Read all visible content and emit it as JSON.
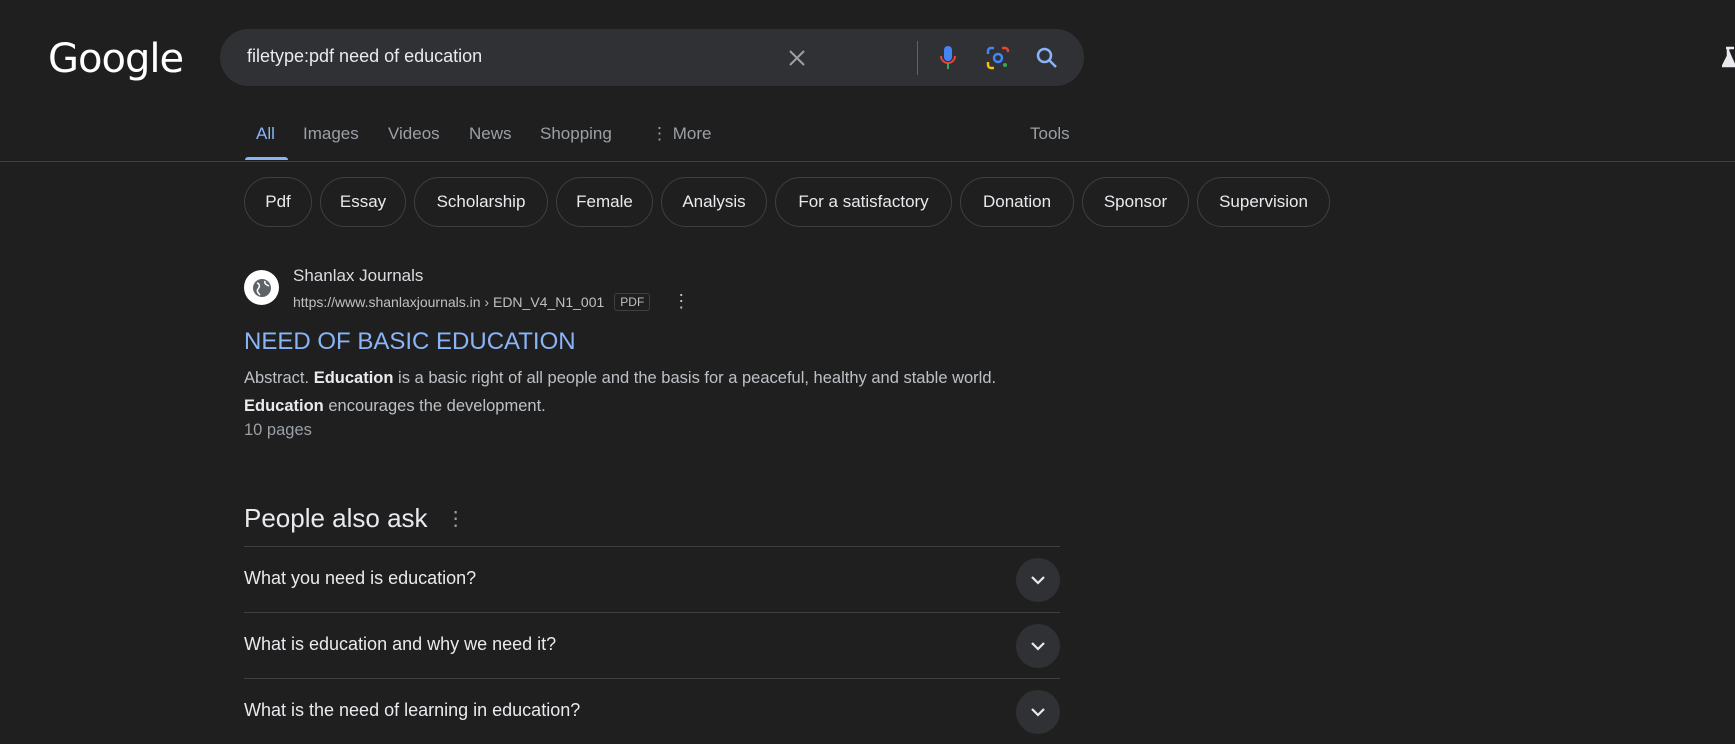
{
  "logo": "Google",
  "search": {
    "query": "filetype:pdf need of education"
  },
  "tabs": [
    {
      "label": "All"
    },
    {
      "label": "Images"
    },
    {
      "label": "Videos"
    },
    {
      "label": "News"
    },
    {
      "label": "Shopping"
    },
    {
      "label": "More"
    }
  ],
  "tools_label": "Tools",
  "chips": [
    "Pdf",
    "Essay",
    "Scholarship",
    "Female",
    "Analysis",
    "For a satisfactory",
    "Donation",
    "Sponsor",
    "Supervision"
  ],
  "result": {
    "site": "Shanlax Journals",
    "url": "https://www.shanlaxjournals.in › EDN_V4_N1_001",
    "badge": "PDF",
    "title": "NEED OF BASIC EDUCATION",
    "snippet": {
      "a": "Abstract. ",
      "b1": "Education",
      "c": " is a basic right of all people and the basis for a peaceful, healthy and stable world. ",
      "b2": "Education",
      "d": " encourages the development."
    },
    "pages": "10 pages"
  },
  "paa": {
    "heading": "People also ask",
    "questions": [
      "What you need is education?",
      "What is education and why we need it?",
      "What is the need of learning in education?"
    ]
  },
  "colors": {
    "background": "#1f1f1f",
    "link": "#8ab4f8",
    "searchbox": "#303134"
  }
}
